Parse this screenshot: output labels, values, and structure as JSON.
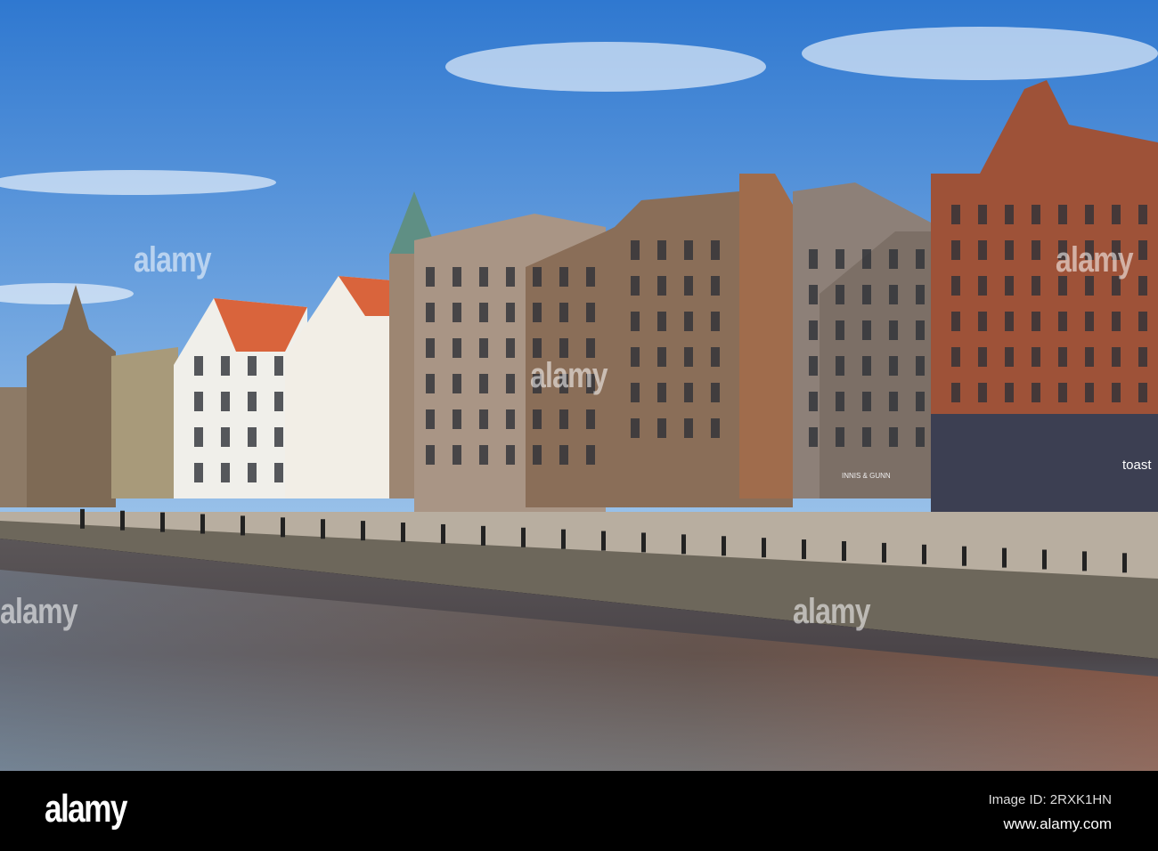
{
  "photo": {
    "scene": "canal-side street with tenement buildings",
    "signs": {
      "pub": "INNIS & GUNN",
      "cafe": "toast"
    },
    "colors": {
      "sky": "#3f86d6",
      "water": "#4a4a4e",
      "sandstone": "#8a6a55",
      "red_sandstone": "#a0533c",
      "footer": "#000000"
    }
  },
  "watermark": {
    "text": "alamy"
  },
  "footer": {
    "logo": "alamy",
    "image_id": "Image ID: 2RXK1HN",
    "url": "www.alamy.com"
  }
}
